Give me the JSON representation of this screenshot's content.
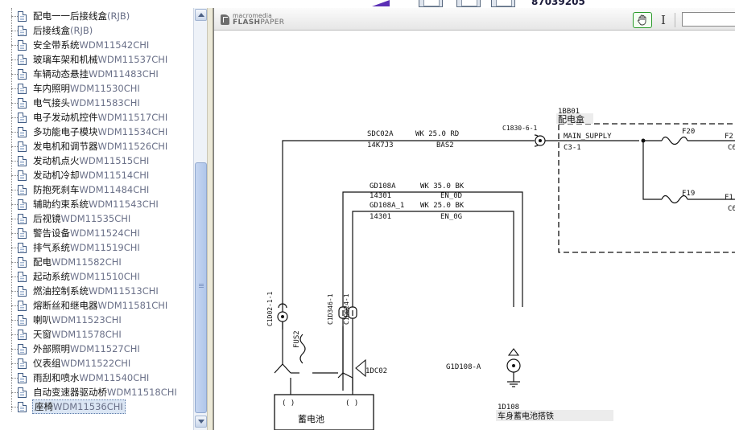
{
  "top": {
    "phone_number": "87039205"
  },
  "tree": {
    "items": [
      {
        "label": "配电一一后接线盒(RJB)",
        "selected": false
      },
      {
        "label": "后接线盒(RJB)",
        "selected": false
      },
      {
        "label": "安全带系统WDM11542CHI",
        "selected": false
      },
      {
        "label": "玻璃车架和机械WDM11537CHI",
        "selected": false
      },
      {
        "label": "车辆动态悬挂WDM11483CHI",
        "selected": false
      },
      {
        "label": "车内照明WDM11530CHI",
        "selected": false
      },
      {
        "label": "电气接头WDM11583CHI",
        "selected": false
      },
      {
        "label": "电子发动机控件WDM11517CHI",
        "selected": false
      },
      {
        "label": "多功能电子模块WDM11534CHI",
        "selected": false
      },
      {
        "label": "发电机和调节器WDM11526CHI",
        "selected": false
      },
      {
        "label": "发动机点火WDM11515CHI",
        "selected": false
      },
      {
        "label": "发动机冷却WDM11514CHI",
        "selected": false
      },
      {
        "label": "防抱死刹车WDM11484CHI",
        "selected": false
      },
      {
        "label": "辅助约束系统WDM11543CHI",
        "selected": false
      },
      {
        "label": "后视镜WDM11535CHI",
        "selected": false
      },
      {
        "label": "警告设备WDM11524CHI",
        "selected": false
      },
      {
        "label": "排气系统WDM11519CHI",
        "selected": false
      },
      {
        "label": "配电WDM11582CHI",
        "selected": false
      },
      {
        "label": "起动系统WDM11510CHI",
        "selected": false
      },
      {
        "label": "燃油控制系统WDM11513CHI",
        "selected": false
      },
      {
        "label": "熔断丝和继电器WDM11581CHI",
        "selected": false
      },
      {
        "label": "喇叭WDM11523CHI",
        "selected": false
      },
      {
        "label": "天窗WDM11578CHI",
        "selected": false
      },
      {
        "label": "外部照明WDM11527CHI",
        "selected": false
      },
      {
        "label": "仪表组WDM11522CHI",
        "selected": false
      },
      {
        "label": "雨刮和喷水WDM11540CHI",
        "selected": false
      },
      {
        "label": "自动变速器驱动桥WDM11518CHI",
        "selected": false
      },
      {
        "label": "座椅WDM11536CHI",
        "selected": true
      }
    ]
  },
  "viewer": {
    "brand_top": "macromedia",
    "brand_bottom_bold": "FLASH",
    "brand_bottom_light": "PAPER",
    "text_tool_glyph": "I",
    "search_value": ""
  },
  "diagram": {
    "box_id": "1BB01",
    "box_name": "配电盒",
    "connector_c1830": "C1830-6-1",
    "wire1_name": "SDC02A",
    "wire1_spec": "WK  25.0  RD",
    "wire1_code": "14K7J3",
    "wire1_circuit": "BAS2",
    "main_supply": "MAIN_SUPPLY",
    "c3_pin": "C3-1",
    "fuse_f20": "F20",
    "fuse_f19": "F19",
    "right_f20_top": "F2",
    "right_f20_bottom": "C6",
    "right_f19_top": "F1",
    "right_f19_bottom": "C6",
    "wire2_name": "GD108A",
    "wire2_spec": "WK  35.0  BK",
    "wire2_code": "14301",
    "wire2_circuit": "EN_0D",
    "wire3_name": "GD108A_1",
    "wire3_spec": "WK  25.0  BK",
    "wire3_code": "14301",
    "wire3_circuit": "EN_0G",
    "conn_left": "C1D02-1-1",
    "conn_mid1": "C1D346-1",
    "conn_mid2": "C1D024-1",
    "fuse_label": "FUS2",
    "ground_mid": "1DC02",
    "ground_right": "G1D108-A",
    "ground_id": "1D108",
    "ground_name": "车身蓄电池搭铁",
    "battery_plus": "( )",
    "battery_minus": "( )",
    "battery_name": "蓄电池"
  }
}
